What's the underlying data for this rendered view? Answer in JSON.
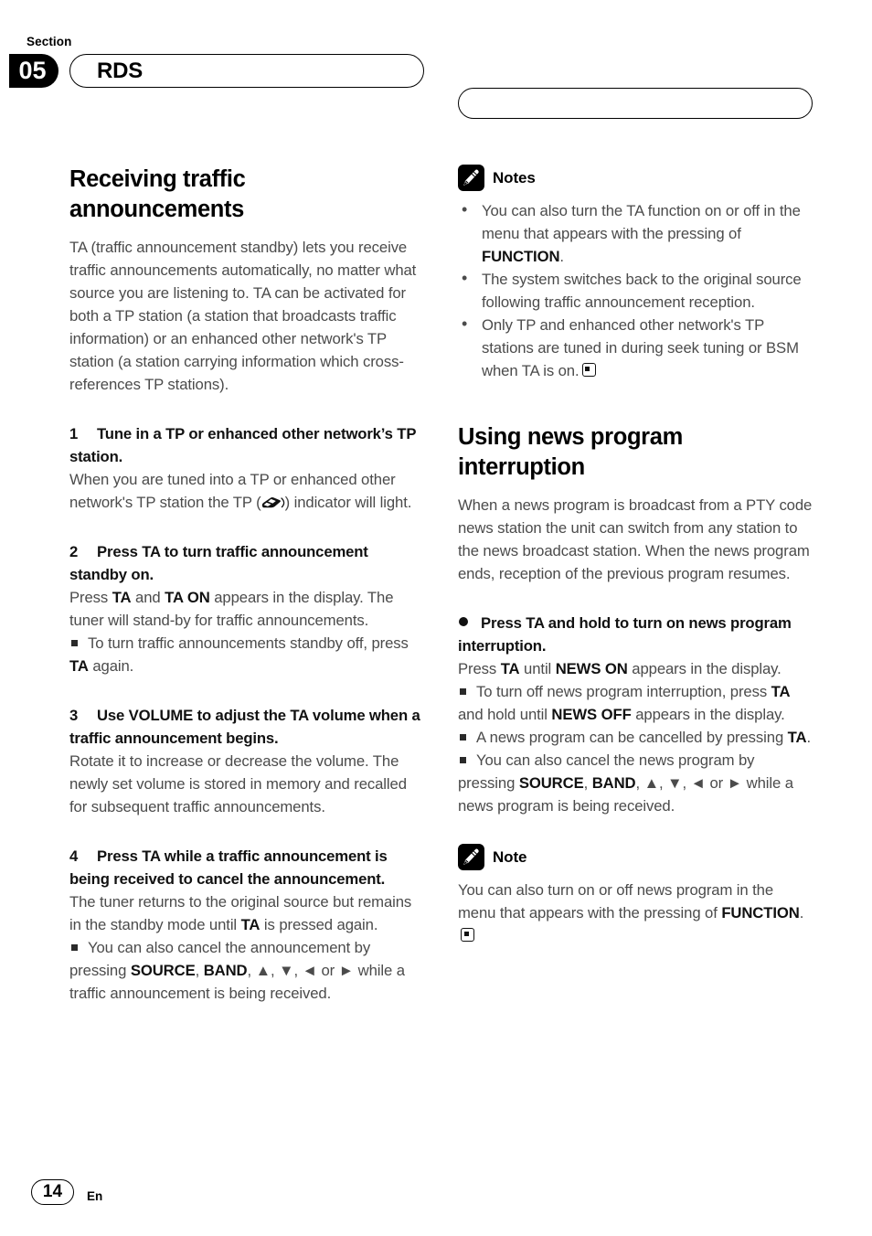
{
  "header": {
    "section_label": "Section",
    "section_number": "05",
    "chapter_title": "RDS",
    "right_pill_text": ""
  },
  "left_column": {
    "title": "Receiving traffic announcements",
    "intro": "TA (traffic announcement standby) lets you receive traffic announcements automatically, no matter what source you are listening to. TA can be activated for both a TP station (a station that broadcasts traffic information) or an enhanced other network's TP station (a station carrying information which cross-references TP stations).",
    "steps": [
      {
        "number": "1",
        "heading": "Tune in a TP or enhanced other network’s TP station.",
        "body_before_icon": "When you are tuned into a TP or enhanced other network's TP station the TP (",
        "icon_name": "tp-car-icon",
        "body_after_icon": ") indicator will light."
      },
      {
        "number": "2",
        "heading": "Press TA to turn traffic announcement standby on.",
        "body_parts": [
          "Press ",
          "TA",
          " and ",
          "TA ON",
          " appears in the display. The tuner will stand-by for traffic announcements."
        ],
        "sub_notes": [
          {
            "parts": [
              "To turn traffic announcements standby off, press ",
              "TA",
              " again."
            ]
          }
        ]
      },
      {
        "number": "3",
        "heading": "Use VOLUME to adjust the TA volume when a traffic announcement begins.",
        "body": "Rotate it to increase or decrease the volume. The newly set volume is stored in memory and recalled for subsequent traffic announcements."
      },
      {
        "number": "4",
        "heading": "Press TA while a traffic announcement is being received to cancel the announcement.",
        "body_parts": [
          "The tuner returns to the original source but remains in the standby mode until ",
          "TA",
          " is pressed again."
        ],
        "sub_notes": [
          {
            "parts": [
              "You can also cancel the announcement by pressing ",
              "SOURCE",
              ", ",
              "BAND",
              ", ▲, ▼, ◄ or ► while a traffic announcement is being received."
            ]
          }
        ]
      }
    ]
  },
  "right_column": {
    "notes_block": {
      "icon_name": "pencil-icon",
      "title": "Notes",
      "items": [
        {
          "parts": [
            "You can also turn the TA function on or off in the menu that appears with the pressing of ",
            "FUNCTION",
            "."
          ],
          "end_marker": false
        },
        {
          "parts": [
            "The system switches back to the original source following traffic announcement reception."
          ],
          "end_marker": false
        },
        {
          "parts": [
            "Only TP and enhanced other network's TP stations are tuned in during seek tuning or BSM when TA is on."
          ],
          "end_marker": true
        }
      ]
    },
    "title": "Using news program interruption",
    "intro": "When a news program is broadcast from a PTY code news station the unit can switch from any station to the news broadcast station. When the news program ends, reception of the previous program resumes.",
    "action": {
      "heading": "Press TA and hold to turn on news program interruption.",
      "body_parts": [
        "Press ",
        "TA",
        " until ",
        "NEWS ON",
        " appears in the display."
      ],
      "sub_notes": [
        {
          "parts": [
            "To turn off news program interruption, press ",
            "TA",
            " and hold until ",
            "NEWS OFF",
            " appears in the display."
          ]
        },
        {
          "parts": [
            "A news program can be cancelled by pressing ",
            "TA",
            "."
          ]
        },
        {
          "parts": [
            "You can also cancel the news program by pressing ",
            "SOURCE",
            ", ",
            "BAND",
            ", ▲, ▼, ◄ or ► while a news program is being received."
          ]
        }
      ]
    },
    "note_block": {
      "icon_name": "pencil-icon",
      "title": "Note",
      "body_parts": [
        "You can also turn on or off news program in the menu that appears with the pressing of ",
        "FUNCTION",
        "."
      ],
      "end_marker": true
    }
  },
  "footer": {
    "page_number": "14",
    "language": "En"
  }
}
